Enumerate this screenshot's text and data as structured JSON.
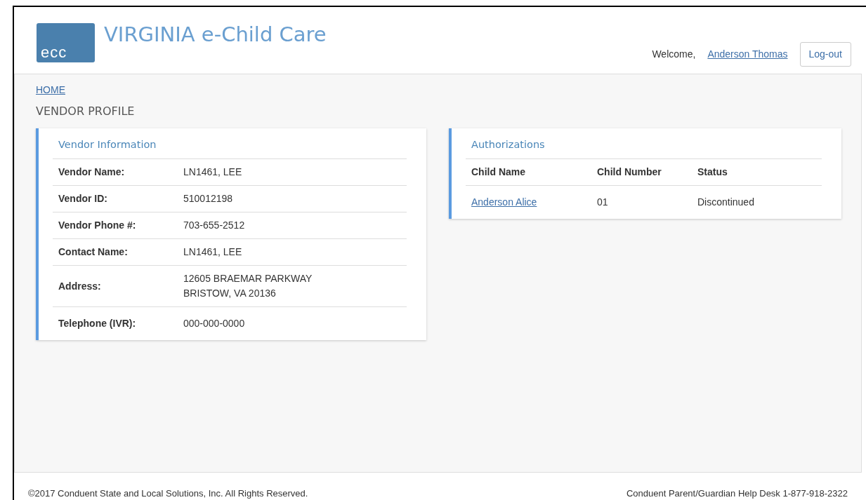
{
  "header": {
    "logo_text": "ecc",
    "title": "VIRGINIA e-Child Care",
    "welcome": "Welcome,",
    "user_link": "Anderson Thomas",
    "logout_button": "Log-out"
  },
  "breadcrumb": "HOME",
  "page_title": "VENDOR PROFILE",
  "vendor_card": {
    "title": "Vendor Information",
    "rows": [
      {
        "label": "Vendor Name:",
        "value": [
          "LN1461, LEE"
        ]
      },
      {
        "label": "Vendor ID:",
        "value": [
          "510012198"
        ]
      },
      {
        "label": "Vendor Phone #:",
        "value": [
          "703-655-2512"
        ]
      },
      {
        "label": "Contact Name:",
        "value": [
          "LN1461, LEE"
        ]
      },
      {
        "label": "Address:",
        "value": [
          "12605 BRAEMAR PARKWAY",
          "BRISTOW, VA 20136"
        ]
      },
      {
        "label": "Telephone (IVR):",
        "value": [
          "000-000-0000"
        ]
      }
    ]
  },
  "authorizations_card": {
    "title": "Authorizations",
    "columns": [
      "Child Name",
      "Child Number",
      "Status"
    ],
    "rows": [
      {
        "child_name": "Anderson Alice",
        "child_number": "01",
        "status": "Discontinued"
      }
    ]
  },
  "footer": {
    "copyright": "©2017 Conduent State and Local Solutions, Inc. All Rights Reserved.",
    "help_desk": "Conduent Parent/Guardian Help Desk 1-877-918-2322"
  }
}
